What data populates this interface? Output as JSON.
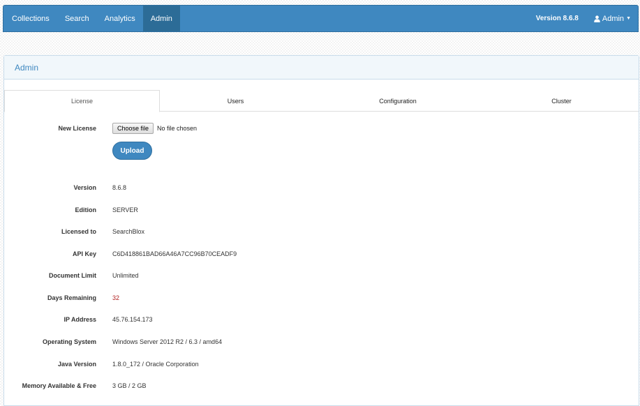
{
  "navbar": {
    "items": [
      "Collections",
      "Search",
      "Analytics",
      "Admin"
    ],
    "version": "Version 8.6.8",
    "user_menu": "Admin"
  },
  "panel": {
    "title": "Admin",
    "tabs": [
      "License",
      "Users",
      "Configuration",
      "Cluster"
    ]
  },
  "license_form": {
    "new_license_label": "New License",
    "choose_file_label": "Choose file",
    "file_status": "No file chosen",
    "upload_label": "Upload"
  },
  "info": [
    {
      "label": "Version",
      "value": "8.6.8"
    },
    {
      "label": "Edition",
      "value": "SERVER"
    },
    {
      "label": "Licensed to",
      "value": "SearchBlox"
    },
    {
      "label": "API Key",
      "value": "C6D418861BAD66A46A7CC96B70CEADF9"
    },
    {
      "label": "Document Limit",
      "value": "Unlimited"
    },
    {
      "label": "Days Remaining",
      "value": "32"
    },
    {
      "label": "IP Address",
      "value": "45.76.154.173"
    },
    {
      "label": "Operating System",
      "value": "Windows Server 2012 R2 / 6.3 / amd64"
    },
    {
      "label": "Java Version",
      "value": "1.8.0_172 / Oracle Corporation"
    },
    {
      "label": "Memory Available & Free",
      "value": "3 GB / 2 GB"
    }
  ],
  "colors": {
    "primary": "#3f88c0",
    "nav_active": "#2c6c97",
    "days_remaining": "#b22222"
  }
}
